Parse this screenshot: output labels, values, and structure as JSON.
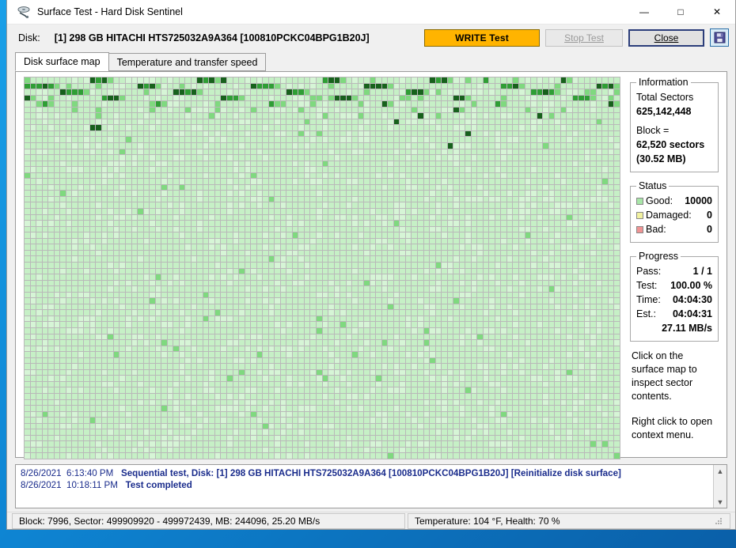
{
  "window": {
    "title": "Surface Test - Hard Disk Sentinel",
    "icon": "disk-scan-icon",
    "buttons": {
      "minimize": "—",
      "maximize": "□",
      "close": "✕"
    }
  },
  "disk_row": {
    "label": "Disk:",
    "value": "[1] 298 GB  HITACHI HTS725032A9A364 [100810PCKC04BPG1B20J]",
    "write_test": "WRITE Test",
    "stop_test": "Stop Test",
    "close": "Close",
    "save_icon": "floppy-save-icon",
    "accent_write": "#ffb400"
  },
  "tabs": [
    {
      "label": "Disk surface map",
      "active": true
    },
    {
      "label": "Temperature and transfer speed",
      "active": false
    }
  ],
  "information": {
    "legend": "Information",
    "total_sectors_label": "Total Sectors",
    "total_sectors_value": "625,142,448",
    "block_label": "Block =",
    "block_value": "62,520 sectors",
    "block_size": "(30.52 MB)"
  },
  "status": {
    "legend": "Status",
    "rows": [
      {
        "label": "Good:",
        "value": "10000",
        "color": "#a8e6a8"
      },
      {
        "label": "Damaged:",
        "value": "0",
        "color": "#f2f2a0"
      },
      {
        "label": "Bad:",
        "value": "0",
        "color": "#f09494"
      }
    ]
  },
  "progress": {
    "legend": "Progress",
    "rows": [
      {
        "label": "Pass:",
        "value": "1 / 1"
      },
      {
        "label": "Test:",
        "value": "100.00 %"
      },
      {
        "label": "Time:",
        "value": "04:04:30"
      },
      {
        "label": "Est.:",
        "value": "04:04:31"
      },
      {
        "label": "",
        "value": "27.11 MB/s"
      }
    ]
  },
  "hints": {
    "hint1": "Click on the surface map to inspect sector contents.",
    "hint2": "Right click to open context menu."
  },
  "log": {
    "line1_date": "8/26/2021",
    "line1_time": "6:13:40 PM",
    "line1_text": "Sequential test, Disk: [1] 298 GB  HITACHI HTS725032A9A364 [100810PCKC04BPG1B20J] [Reinitialize disk surface]",
    "line2_date": "8/26/2021",
    "line2_time": "10:18:11 PM",
    "line2_text": "Test completed",
    "scroll_up": "▲",
    "scroll_down": "▼"
  },
  "statusbar": {
    "left": "Block: 7996, Sector: 499909920 - 499972439, MB: 244096, 25.20 MB/s",
    "right": "Temperature: 104  °F,  Health: 70 %"
  },
  "chart_data": {
    "type": "heatmap",
    "title": "Disk surface map",
    "columns": 100,
    "rows": 64,
    "total_blocks": 10000,
    "legend": [
      "Good",
      "Damaged",
      "Bad"
    ],
    "palette": {
      "base": "#c6f0c6",
      "light": "#d6f5d6",
      "mid": "#7fd97f",
      "dark": "#2f9e35",
      "darker": "#17611c",
      "grid": "#b9b9b9"
    },
    "note": "All 10000 blocks Good; shading varies by access time. Darker cells = slower blocks, concentrated in the first rows.",
    "dark_cells": [
      [
        0,
        11
      ],
      [
        0,
        12
      ],
      [
        0,
        13
      ],
      [
        0,
        29
      ],
      [
        0,
        30
      ],
      [
        0,
        31
      ],
      [
        0,
        33
      ],
      [
        0,
        50
      ],
      [
        0,
        51
      ],
      [
        0,
        52
      ],
      [
        0,
        68
      ],
      [
        0,
        69
      ],
      [
        0,
        70
      ],
      [
        0,
        77
      ],
      [
        0,
        90
      ],
      [
        1,
        0
      ],
      [
        1,
        1
      ],
      [
        1,
        2
      ],
      [
        1,
        3
      ],
      [
        1,
        4
      ],
      [
        1,
        19
      ],
      [
        1,
        20
      ],
      [
        1,
        21
      ],
      [
        1,
        38
      ],
      [
        1,
        39
      ],
      [
        1,
        40
      ],
      [
        1,
        41
      ],
      [
        1,
        57
      ],
      [
        1,
        58
      ],
      [
        1,
        59
      ],
      [
        1,
        60
      ],
      [
        1,
        80
      ],
      [
        1,
        81
      ],
      [
        1,
        82
      ],
      [
        1,
        96
      ],
      [
        1,
        97
      ],
      [
        1,
        98
      ],
      [
        2,
        6
      ],
      [
        2,
        7
      ],
      [
        2,
        8
      ],
      [
        2,
        9
      ],
      [
        2,
        25
      ],
      [
        2,
        26
      ],
      [
        2,
        27
      ],
      [
        2,
        28
      ],
      [
        2,
        44
      ],
      [
        2,
        45
      ],
      [
        2,
        46
      ],
      [
        2,
        64
      ],
      [
        2,
        65
      ],
      [
        2,
        66
      ],
      [
        2,
        85
      ],
      [
        2,
        86
      ],
      [
        2,
        87
      ],
      [
        2,
        88
      ],
      [
        3,
        0
      ],
      [
        3,
        13
      ],
      [
        3,
        14
      ],
      [
        3,
        15
      ],
      [
        3,
        33
      ],
      [
        3,
        34
      ],
      [
        3,
        35
      ],
      [
        3,
        52
      ],
      [
        3,
        53
      ],
      [
        3,
        54
      ],
      [
        3,
        72
      ],
      [
        3,
        73
      ],
      [
        3,
        92
      ],
      [
        3,
        93
      ],
      [
        3,
        94
      ],
      [
        4,
        3
      ],
      [
        4,
        22
      ],
      [
        4,
        41
      ],
      [
        4,
        60
      ],
      [
        4,
        79
      ],
      [
        4,
        98
      ],
      [
        8,
        11
      ],
      [
        8,
        12
      ],
      [
        6,
        66
      ],
      [
        7,
        62
      ],
      [
        9,
        74
      ],
      [
        5,
        72
      ],
      [
        11,
        71
      ],
      [
        6,
        86
      ]
    ],
    "mid_cells": [
      [
        0,
        14
      ],
      [
        0,
        32
      ],
      [
        0,
        53
      ],
      [
        0,
        71
      ],
      [
        0,
        91
      ],
      [
        1,
        5
      ],
      [
        1,
        22
      ],
      [
        1,
        42
      ],
      [
        1,
        61
      ],
      [
        1,
        83
      ],
      [
        1,
        99
      ],
      [
        2,
        10
      ],
      [
        2,
        29
      ],
      [
        2,
        47
      ],
      [
        2,
        67
      ],
      [
        2,
        89
      ],
      [
        3,
        1
      ],
      [
        3,
        16
      ],
      [
        3,
        36
      ],
      [
        3,
        55
      ],
      [
        3,
        74
      ],
      [
        3,
        95
      ],
      [
        4,
        4
      ],
      [
        4,
        23
      ],
      [
        4,
        42
      ],
      [
        4,
        61
      ],
      [
        4,
        80
      ],
      [
        4,
        99
      ],
      [
        5,
        8
      ],
      [
        5,
        27
      ],
      [
        5,
        46
      ],
      [
        5,
        65
      ],
      [
        5,
        84
      ],
      [
        6,
        12
      ],
      [
        6,
        31
      ],
      [
        6,
        50
      ],
      [
        6,
        69
      ],
      [
        6,
        88
      ]
    ]
  }
}
